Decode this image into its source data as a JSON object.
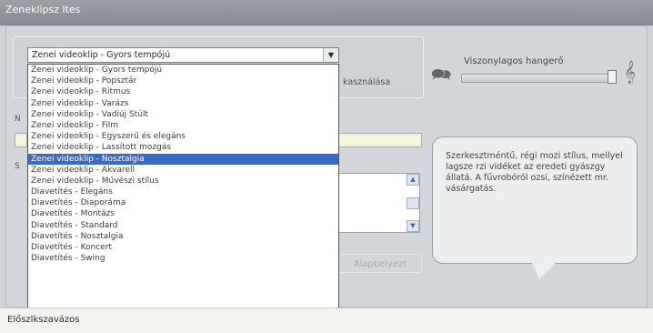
{
  "window": {
    "title": "Zeneklipsz ltes"
  },
  "combo": {
    "value": "Zenei videoklip - Gyors tempójú"
  },
  "dropdown": {
    "items": [
      "Zenei videoklip - Gyors tempójú",
      "Zenei videoklip - Popsztár",
      "Zenei videoklip - Ritmus",
      "Zenei videoklip - Varázs",
      "Zenei videoklip - Vadiúj Stúlt",
      "Zenei videoklip - Film",
      "Zenei videoklip - Egyszerű és elegáns",
      "Zenei videoklip - Lassított mozgás",
      "Zenei videoklip - Nosztalgia",
      "Zenei videoklip - Akvarell",
      "Zenei videoklip - Művészi stílus",
      "Diavetítés - Elegáns",
      "Diavetítés - Diaporáma",
      "Diavetítés - Montázs",
      "Diavetítés - Standard",
      "Diavetítés - Nosztalgia",
      "Diavetítés - Koncert",
      "Diavetítés - Swing"
    ],
    "selected_index": 8
  },
  "right_label": "kasználása",
  "slider": {
    "label": "Viszonylagos hangerő",
    "value": 0.97
  },
  "bubble": {
    "text": "Szerkesztméntű, régi mozi stílus, mellyel lagsze rzi vidéket az eredeti gyászgy állatá. A fűvrobóról ozsi, színézett mr. vásárgatás."
  },
  "button": {
    "label": "Alapbelyezt"
  },
  "status": {
    "text": "Előszlkszavázos"
  }
}
